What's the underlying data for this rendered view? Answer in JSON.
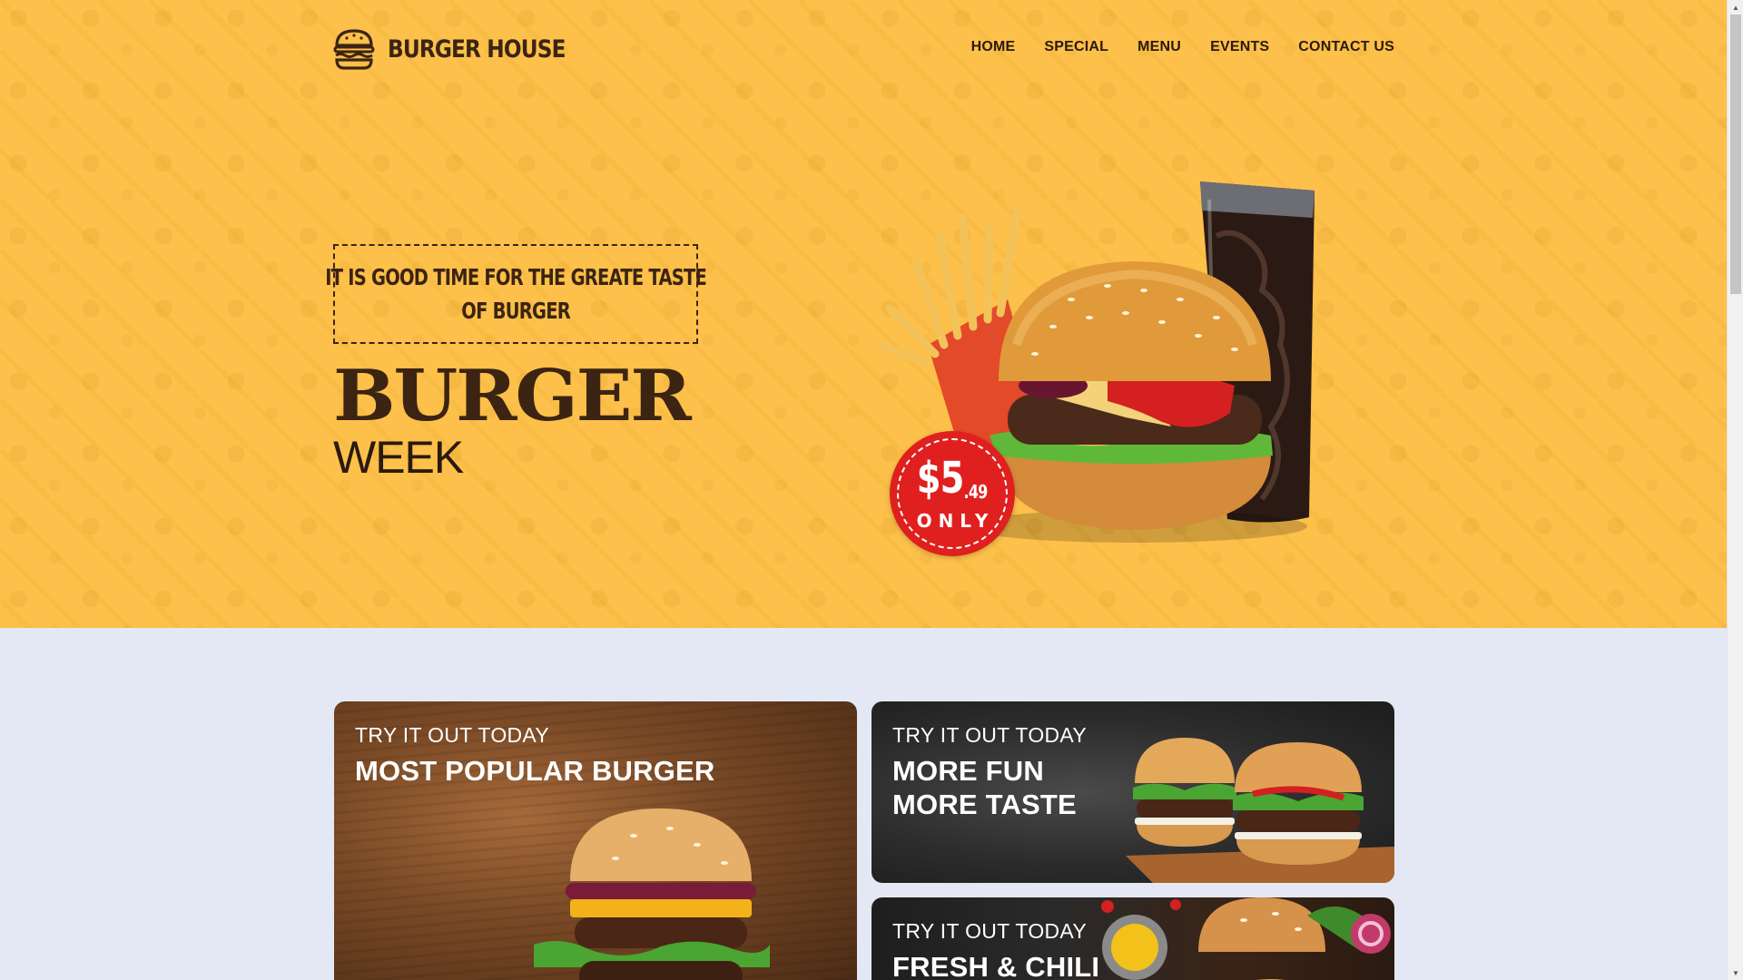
{
  "brand": {
    "name": "BURGER HOUSE",
    "logo_icon": "burger-icon"
  },
  "nav": {
    "items": [
      "HOME",
      "SPECIAL",
      "MENU",
      "EVENTS",
      "CONTACT US"
    ]
  },
  "hero": {
    "tagline_lines": [
      "IT IS GOOD TIME FOR THE GREATE TASTE",
      "OF BURGER"
    ],
    "title": "BURGER",
    "subtitle": "WEEK",
    "price_main": "$5",
    "price_cents": ".49",
    "price_note": "ONLY",
    "image": "burger-fries-cola"
  },
  "cards": [
    {
      "eyebrow": "TRY IT OUT TODAY",
      "title_lines": [
        "MOST POPULAR BURGER"
      ],
      "image": "burger-on-wood"
    },
    {
      "eyebrow": "TRY IT OUT TODAY",
      "title_lines": [
        "MORE FUN",
        "MORE TASTE"
      ],
      "image": "two-burgers-on-board"
    },
    {
      "eyebrow": "TRY IT OUT TODAY",
      "title_lines": [
        "FRESH & CHILI"
      ],
      "image": "burgers-with-sauce"
    }
  ],
  "colors": {
    "hero_bg": "#fdc04a",
    "brand_dark": "#3b2412",
    "badge_red": "#e0201f",
    "section_bg": "#e4e8f5"
  }
}
